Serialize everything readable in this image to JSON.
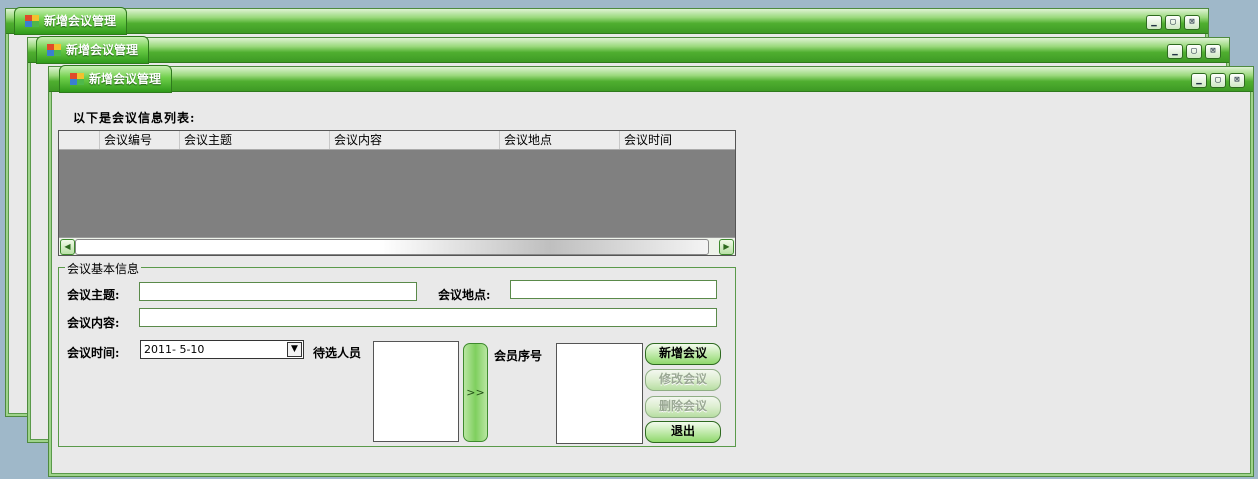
{
  "windows": [
    {
      "title": "新增会议管理"
    },
    {
      "title": "新增会议管理"
    },
    {
      "title": "新增会议管理"
    }
  ],
  "main": {
    "heading": "以下是会议信息列表:",
    "grid": {
      "columns": [
        "会议编号",
        "会议主题",
        "会议内容",
        "会议地点",
        "会议时间"
      ]
    },
    "group_title": "会议基本信息",
    "topic_label": "会议主题:",
    "topic_value": "",
    "location_label": "会议地点:",
    "location_value": "",
    "content_label": "会议内容:",
    "content_value": "",
    "time_label": "会议时间:",
    "time_value": "2011- 5-10",
    "candidates_label": "待选人员",
    "members_label": "会员序号",
    "move_button": ">>",
    "buttons": {
      "add": "新增会议",
      "edit": "修改会议",
      "delete": "删除会议",
      "exit": "退出"
    }
  },
  "colors": {
    "accent": "#4fae2f",
    "titlebar_dark": "#2f7a1d"
  }
}
